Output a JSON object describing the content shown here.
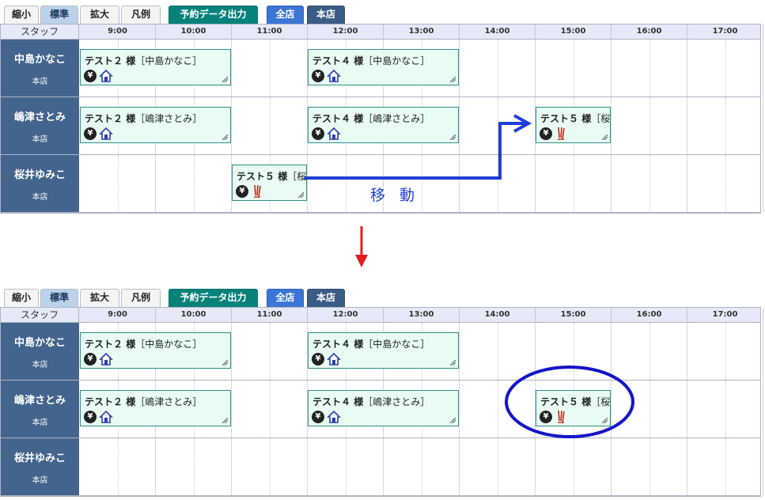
{
  "toolbar": {
    "buttons": [
      {
        "label": "縮小",
        "style": "plain"
      },
      {
        "label": "標準",
        "style": "active"
      },
      {
        "label": "拡大",
        "style": "plain"
      },
      {
        "label": "凡例",
        "style": "plain"
      },
      {
        "label": "予約データ出力",
        "style": "teal"
      },
      {
        "label": "全店",
        "style": "blue"
      },
      {
        "label": "本店",
        "style": "slate"
      }
    ]
  },
  "header": {
    "staff_label": "スタッフ",
    "times": [
      "9:00",
      "10:00",
      "11:00",
      "12:00",
      "13:00",
      "14:00",
      "15:00",
      "16:00",
      "17:00"
    ]
  },
  "staff": [
    {
      "name": "中島かなこ",
      "shop": "本店"
    },
    {
      "name": "嶋津さとみ",
      "shop": "本店"
    },
    {
      "name": "桜井ゆみこ",
      "shop": "本店"
    }
  ],
  "panels": {
    "before": {
      "appointments": [
        {
          "row": 0,
          "start": "9:00",
          "end": "11:00",
          "customer": "テスト２",
          "honorific": "様",
          "staff_tag": "［中島かなこ］",
          "icons": [
            "yen-icon",
            "home-icon"
          ]
        },
        {
          "row": 0,
          "start": "12:00",
          "end": "14:00",
          "customer": "テスト４",
          "honorific": "様",
          "staff_tag": "［中島かなこ］",
          "icons": [
            "yen-icon",
            "home-icon"
          ]
        },
        {
          "row": 1,
          "start": "9:00",
          "end": "11:00",
          "customer": "テスト２",
          "honorific": "様",
          "staff_tag": "［嶋津さとみ］",
          "icons": [
            "yen-icon",
            "home-icon"
          ]
        },
        {
          "row": 1,
          "start": "12:00",
          "end": "14:00",
          "customer": "テスト４",
          "honorific": "様",
          "staff_tag": "［嶋津さとみ］",
          "icons": [
            "yen-icon",
            "home-icon"
          ]
        },
        {
          "row": 1,
          "start": "15:00",
          "end": "16:00",
          "customer": "テスト５",
          "honorific": "様",
          "staff_tag": "［桜",
          "icons": [
            "yen-icon",
            "scissors-icon"
          ]
        },
        {
          "row": 2,
          "start": "11:00",
          "end": "12:00",
          "customer": "テスト５",
          "honorific": "様",
          "staff_tag": "［桜",
          "icons": [
            "yen-icon",
            "scissors-icon"
          ]
        }
      ]
    },
    "after": {
      "appointments": [
        {
          "row": 0,
          "start": "9:00",
          "end": "11:00",
          "customer": "テスト２",
          "honorific": "様",
          "staff_tag": "［中島かなこ］",
          "icons": [
            "yen-icon",
            "home-icon"
          ]
        },
        {
          "row": 0,
          "start": "12:00",
          "end": "14:00",
          "customer": "テスト４",
          "honorific": "様",
          "staff_tag": "［中島かなこ］",
          "icons": [
            "yen-icon",
            "home-icon"
          ]
        },
        {
          "row": 1,
          "start": "9:00",
          "end": "11:00",
          "customer": "テスト２",
          "honorific": "様",
          "staff_tag": "［嶋津さとみ］",
          "icons": [
            "yen-icon",
            "home-icon"
          ]
        },
        {
          "row": 1,
          "start": "12:00",
          "end": "14:00",
          "customer": "テスト４",
          "honorific": "様",
          "staff_tag": "［嶋津さとみ］",
          "icons": [
            "yen-icon",
            "home-icon"
          ]
        },
        {
          "row": 1,
          "start": "15:00",
          "end": "16:00",
          "customer": "テスト５",
          "honorific": "様",
          "staff_tag": "［桜",
          "icons": [
            "yen-icon",
            "scissors-icon"
          ]
        }
      ]
    }
  },
  "annotation": {
    "move_label": "移動",
    "arrow_color": "#1f3fd6",
    "down_arrow_color": "#e02020",
    "circle_color": "#1414c8"
  },
  "colors": {
    "staff_bg": "#43648c",
    "appt_bg": "#e8fcf3",
    "appt_border": "#2f8f88",
    "header_bg": "#e6e9f7"
  }
}
